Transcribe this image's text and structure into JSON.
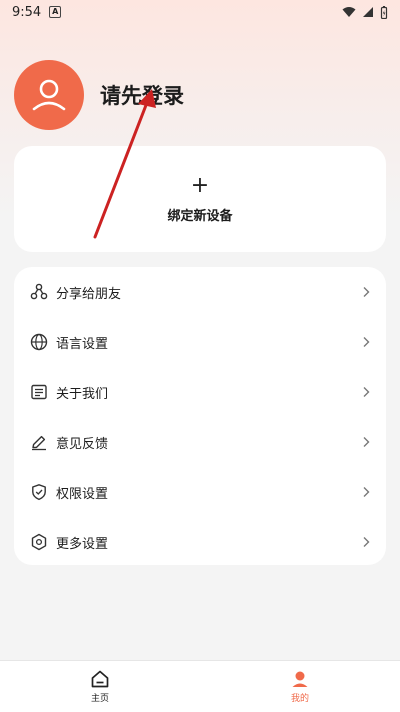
{
  "status_bar": {
    "time": "9:54",
    "badge": "A"
  },
  "profile": {
    "login_text": "请先登录",
    "avatar_color": "#f06a4a"
  },
  "bind_device": {
    "plus": "+",
    "label": "绑定新设备"
  },
  "menu": {
    "items": [
      {
        "label": "分享给朋友",
        "icon": "share-icon"
      },
      {
        "label": "语言设置",
        "icon": "globe-icon"
      },
      {
        "label": "关于我们",
        "icon": "document-icon"
      },
      {
        "label": "意见反馈",
        "icon": "pencil-icon"
      },
      {
        "label": "权限设置",
        "icon": "shield-icon"
      },
      {
        "label": "更多设置",
        "icon": "hexagon-settings-icon"
      }
    ]
  },
  "bottom_nav": {
    "items": [
      {
        "label": "主页",
        "icon": "home-icon",
        "active": false
      },
      {
        "label": "我的",
        "icon": "person-icon",
        "active": true
      }
    ]
  },
  "colors": {
    "accent": "#f06a4a",
    "annotation": "#cc2222"
  }
}
